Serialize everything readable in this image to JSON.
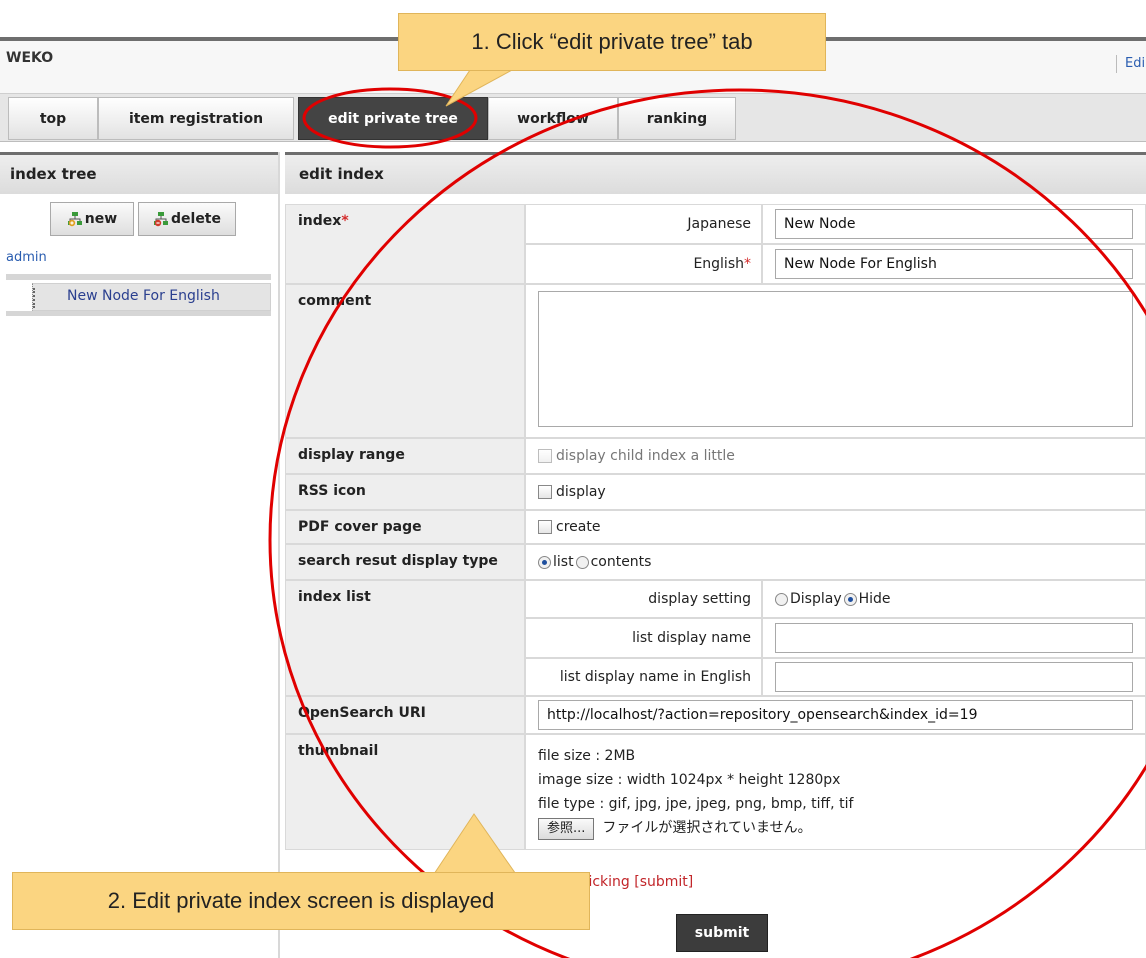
{
  "header": {
    "brand": "WEKO",
    "edit_link": "Edi"
  },
  "tabs": [
    {
      "label": "top"
    },
    {
      "label": "item registration"
    },
    {
      "label": "edit private tree"
    },
    {
      "label": "workflow"
    },
    {
      "label": "ranking"
    }
  ],
  "sidebar": {
    "title": "index tree",
    "new_button": "new",
    "delete_button": "delete",
    "root": "admin",
    "node": "New Node For English"
  },
  "panel": {
    "title": "edit index",
    "index_label": "index",
    "required_mark": "*",
    "japanese_label": "Japanese",
    "japanese_value": "New Node",
    "english_label": "English",
    "english_value": "New Node For English",
    "comment_label": "comment",
    "display_range_label": "display range",
    "display_range_option": "display child index a little",
    "rss_label": "RSS icon",
    "rss_option": "display",
    "pdf_label": "PDF cover page",
    "pdf_option": "create",
    "search_type_label": "search resut display type",
    "search_type_list": "list",
    "search_type_contents": "contents",
    "index_list_label": "index list",
    "display_setting_label": "display setting",
    "display_option": "Display",
    "hide_option": "Hide",
    "list_name_label": "list display name",
    "list_name_en_label": "list display name in English",
    "opensearch_label": "OpenSearch URI",
    "opensearch_value": "http://localhost/?action=repository_opensearch&index_id=19",
    "thumbnail_label": "thumbnail",
    "file_size": "file size : 2MB",
    "image_size": "image size : width 1024px * height 1280px",
    "file_type": "file type : gif, jpg, jpe, jpeg, png, bmp, tiff, tif",
    "browse_button": "参照...",
    "no_file": "ファイルが選択されていません。",
    "note": "be registered unless clicking [submit]",
    "submit": "submit"
  },
  "annotations": {
    "step1": "1. Click “edit private tree” tab",
    "step2": "2. Edit private index screen is displayed"
  },
  "colors": {
    "callout": "#fbd581",
    "circle": "#e00000",
    "active_tab": "#444444",
    "link": "#2a5db0",
    "required": "#d42a2a"
  }
}
